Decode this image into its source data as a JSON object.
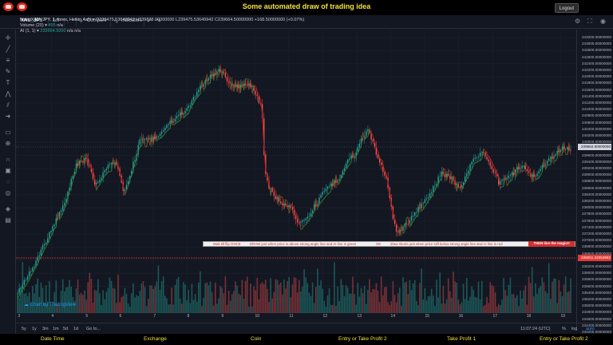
{
  "header": {
    "title": "Some automated draw of trading idea",
    "logout_label": "Logout"
  },
  "toolbar": {
    "symbol": "XAU_JPY",
    "interval": "1m",
    "compare_label": "Compare",
    "indicators_label": "Indicators"
  },
  "legend": {
    "symbol_line": "forex:XAU_JPY, 1, forex, Heikin Ashi",
    "ohlc": "O239475.53649942  H239828.00000000  L239475.53649942  C239664.50000000  +168.50000000 (+0.07%)",
    "volume_label": "Volume (20)",
    "volume_value": "495",
    "volume_na": "n/a",
    "ai_label": "AI (1, 1)",
    "ai_value": "239664.5000",
    "ai_na1": "n/a",
    "ai_na2": "n/a"
  },
  "price_axis": {
    "labels": [
      "243200.00000000",
      "243000.00000000",
      "242800.00000000",
      "242600.00000000",
      "242400.00000000",
      "242200.00000000",
      "242000.00000000",
      "241800.00000000",
      "241600.00000000",
      "241400.00000000",
      "241200.00000000",
      "241000.00000000",
      "240800.00000000",
      "240600.00000000",
      "240400.00000000",
      "240200.00000000",
      "240000.00000000",
      "239800.00000000",
      "239600.00000000",
      "239400.00000000",
      "239200.00000000",
      "239000.00000000",
      "238800.00000000",
      "238600.00000000",
      "238400.00000000",
      "238200.00000000",
      "238000.00000000",
      "237800.00000000",
      "237600.00000000",
      "237400.00000000",
      "237200.00000000",
      "237000.00000000",
      "236800.00000000",
      "236600.00000000",
      "236400.00000000",
      "236200.00000000",
      "236000.00000000",
      "235800.00000000",
      "235600.00000000",
      "235400.00000000",
      "235200.00000000",
      "235000.00000000",
      "234800.00000000",
      "234600.00000000",
      "234400.00000000",
      "234200.00000000",
      "234000.00000000",
      "233800.00000000",
      "233600.00000000"
    ],
    "current_price": "239664.50000000",
    "line_price": "235051.22053992"
  },
  "time_axis": {
    "labels": [
      "3",
      "4",
      "5",
      "6",
      "7",
      "8",
      "9",
      "10",
      "11",
      "12",
      "13",
      "14",
      "15",
      "16",
      "17",
      "18",
      "19"
    ]
  },
  "bottom_bar": {
    "ranges": [
      "5y",
      "1y",
      "3m",
      "1m",
      "5d",
      "1d",
      "Go to..."
    ],
    "clock": "11:07:24 (UTC)",
    "pct": "%",
    "log": "log",
    "auto": "auto"
  },
  "annotation": {
    "text1": "Wait till flip ONCE",
    "text2": "DRAW just when price is above strong angle line and AI line is green",
    "text3": "OK",
    "text4": "draw shorts just when price still below strong angle line and AI line is red",
    "box": "THEN line the magic!!"
  },
  "watermark": "Chart by TradingView",
  "footer": {
    "items": [
      "Date Time",
      "Exchange",
      "Coin",
      "Entry or Take Profit 2",
      "Take Profit 1",
      "Entry or Take Profit 2"
    ]
  },
  "colors": {
    "up": "#26a69a",
    "down": "#ef5350",
    "accent": "#f3e23b",
    "line": "#e53935"
  }
}
